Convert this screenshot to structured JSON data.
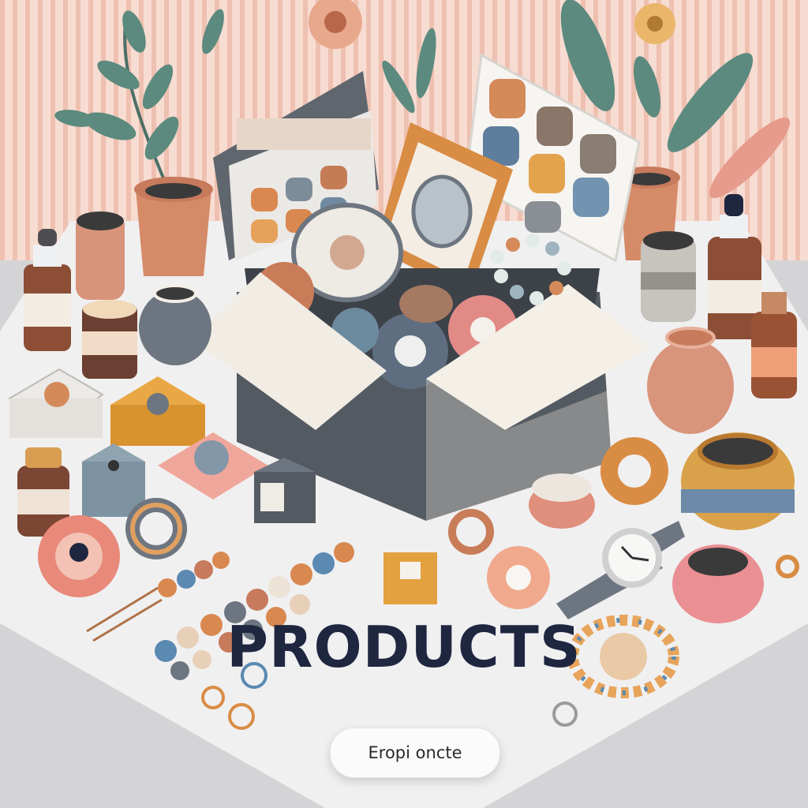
{
  "headline": "PRODUCTS",
  "cta": {
    "label": "Eropi oncte"
  },
  "colors": {
    "background_stripes": "#f1c7b9",
    "table": "#efeff0",
    "floor": "#d4d4d7",
    "terracotta": "#d89072",
    "slate": "#6d7680",
    "mustard": "#d9a24a",
    "blush": "#ec9e8e",
    "leaf": "#5c8a7e",
    "headline": "#1f2640"
  },
  "icons": [
    "potted-plant-icon",
    "jar-icon",
    "dropper-bottle-icon",
    "vase-icon",
    "gift-box-icon",
    "photo-frame-icon",
    "bead-bracelet-icon",
    "wristwatch-icon",
    "flower-icon",
    "ring-icon",
    "cube-icon",
    "display-tray-icon"
  ]
}
